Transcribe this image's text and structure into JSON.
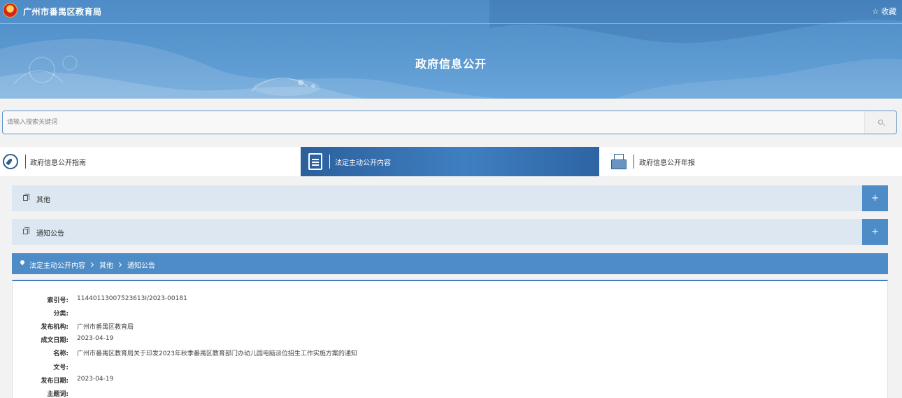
{
  "header": {
    "site_title": "广州市番禺区教育局",
    "favorite_label": "收藏",
    "page_heading": "政府信息公开"
  },
  "search": {
    "placeholder": "请输入搜索关键词"
  },
  "tabs": [
    {
      "label": "政府信息公开指南",
      "icon": "compass-icon",
      "active": false
    },
    {
      "label": "法定主动公开内容",
      "icon": "document-icon",
      "active": true
    },
    {
      "label": "政府信息公开年报",
      "icon": "folder-icon",
      "active": false
    }
  ],
  "categories": [
    {
      "label": "其他",
      "toggle": "+"
    },
    {
      "label": "通知公告",
      "toggle": "+"
    }
  ],
  "breadcrumb": [
    "法定主动公开内容",
    "其他",
    "通知公告"
  ],
  "info": [
    {
      "key": "索引号:",
      "value": "11440113007523613I/2023-00181"
    },
    {
      "key": "分类:",
      "value": ""
    },
    {
      "key": "发布机构:",
      "value": "广州市番禺区教育局"
    },
    {
      "key": "成文日期:",
      "value": "2023-04-19"
    },
    {
      "key": "名称:",
      "value": "广州市番禺区教育局关于印发2023年秋季番禺区教育部门办幼儿园电脑派位招生工作实施方案的通知"
    },
    {
      "key": "文号:",
      "value": ""
    },
    {
      "key": "发布日期:",
      "value": "2023-04-19"
    },
    {
      "key": "主题词:",
      "value": ""
    }
  ],
  "colors": {
    "accent": "#4d8cc6",
    "banner": "#5a98d0",
    "active_tab": "#3f7fc1",
    "category_bg": "#dde7f1"
  }
}
